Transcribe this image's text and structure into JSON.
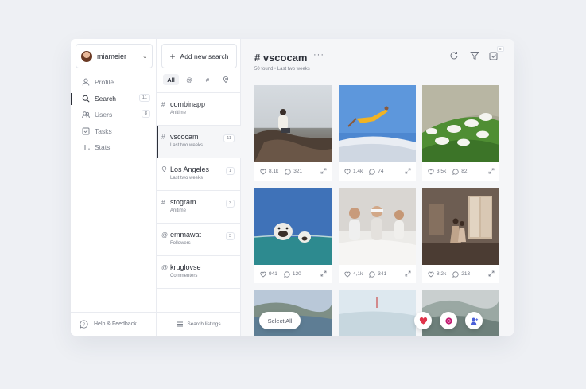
{
  "account": {
    "name": "miameier"
  },
  "nav": {
    "items": [
      {
        "label": "Profile",
        "icon": "person-icon",
        "badge": ""
      },
      {
        "label": "Search",
        "icon": "search-icon",
        "badge": "11"
      },
      {
        "label": "Users",
        "icon": "users-icon",
        "badge": "8"
      },
      {
        "label": "Tasks",
        "icon": "tasks-icon",
        "badge": ""
      },
      {
        "label": "Stats",
        "icon": "stats-icon",
        "badge": ""
      }
    ],
    "footer": "Help & Feedback"
  },
  "searches": {
    "add_label": "Add new search",
    "filters": [
      "All",
      "@",
      "#",
      "location-icon"
    ],
    "items": [
      {
        "prefix": "#",
        "title": "combinapp",
        "sub": "Anitime",
        "badge": ""
      },
      {
        "prefix": "#",
        "title": "vscocam",
        "sub": "Last two weeks",
        "badge": "11"
      },
      {
        "prefix": "pin",
        "title": "Los Angeles",
        "sub": "Last two weeks",
        "badge": "1"
      },
      {
        "prefix": "#",
        "title": "stogram",
        "sub": "Anitime",
        "badge": "3"
      },
      {
        "prefix": "@",
        "title": "emmawat",
        "sub": "Followers",
        "badge": "3"
      },
      {
        "prefix": "@",
        "title": "kruglovse",
        "sub": "Commenters",
        "badge": ""
      }
    ],
    "footer": "Search listings"
  },
  "main": {
    "title": "# vscocam",
    "more": "···",
    "subtitle": "50 found  •  Last two weeks",
    "tools_badge": "8",
    "posts": [
      {
        "likes": "8,1k",
        "comments": "321"
      },
      {
        "likes": "1,4k",
        "comments": "74"
      },
      {
        "likes": "3,5k",
        "comments": "82"
      },
      {
        "likes": "941",
        "comments": "120"
      },
      {
        "likes": "4,1k",
        "comments": "341"
      },
      {
        "likes": "8,2k",
        "comments": "213"
      }
    ],
    "select_all": "Select All"
  },
  "colors": {
    "accent": "#2b2f38",
    "heart": "#e0334a",
    "insta": "#c0186f",
    "user": "#4a5fd8",
    "tag": "#3a6fe0"
  }
}
